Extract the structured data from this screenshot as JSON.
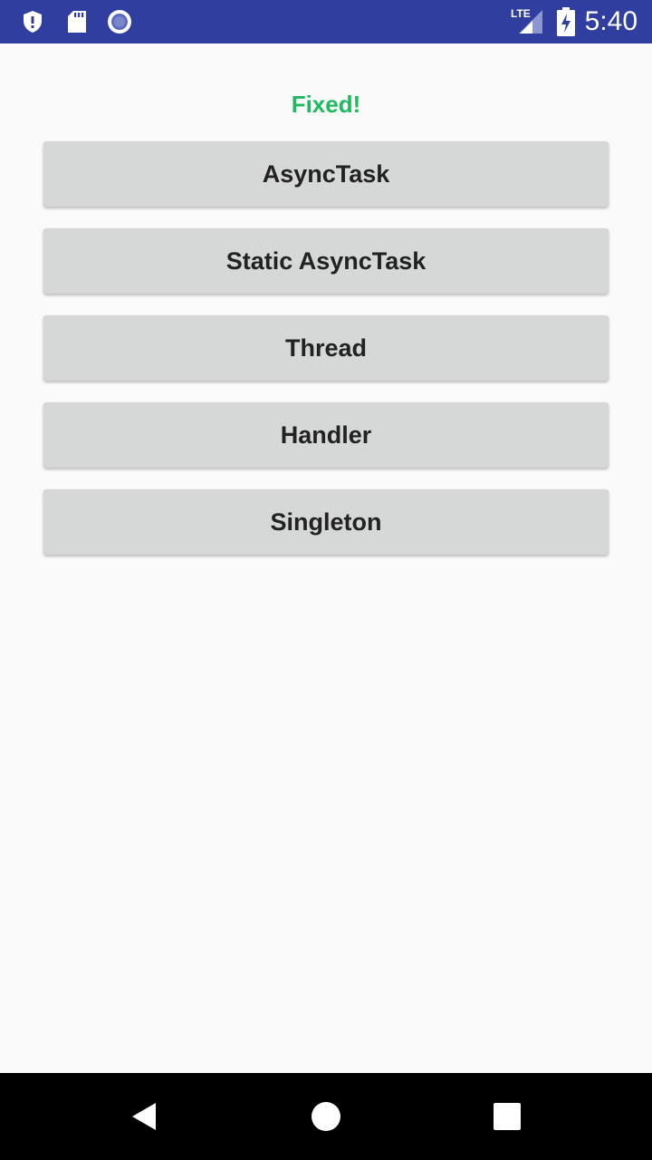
{
  "status_bar": {
    "time": "5:40",
    "network_label": "LTE",
    "icons": [
      "shield-icon",
      "sd-card-icon",
      "circle-record-icon",
      "lte-signal-icon",
      "battery-charging-icon"
    ]
  },
  "main": {
    "status_text": "Fixed!",
    "status_color": "#21b95f",
    "buttons": [
      {
        "label": "AsyncTask"
      },
      {
        "label": "Static AsyncTask"
      },
      {
        "label": "Thread"
      },
      {
        "label": "Handler"
      },
      {
        "label": "Singleton"
      }
    ]
  },
  "nav_bar": {
    "icons": [
      "back-icon",
      "home-icon",
      "recents-icon"
    ]
  },
  "colors": {
    "status_bar": "#303f9f",
    "button_bg": "#d6d7d7",
    "background": "#fafafa"
  }
}
